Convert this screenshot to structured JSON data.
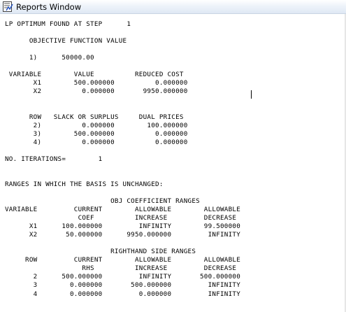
{
  "window": {
    "title": "Reports Window",
    "icon": "report-document-icon"
  },
  "report": {
    "lines": [
      "LP OPTIMUM FOUND AT STEP      1",
      "",
      "      OBJECTIVE FUNCTION VALUE",
      "",
      "      1)      50000.00",
      "",
      " VARIABLE        VALUE          REDUCED COST",
      "       X1        500.000000          0.000000",
      "       X2          0.000000       9950.000000",
      "",
      "",
      "      ROW   SLACK OR SURPLUS     DUAL PRICES",
      "       2)          0.000000        100.000000",
      "       3)        500.000000          0.000000",
      "       4)          0.000000          0.000000",
      "",
      "NO. ITERATIONS=        1",
      "",
      "",
      "RANGES IN WHICH THE BASIS IS UNCHANGED:",
      "",
      "                          OBJ COEFFICIENT RANGES",
      "VARIABLE         CURRENT        ALLOWABLE        ALLOWABLE",
      "                  COEF          INCREASE         DECREASE",
      "      X1      100.000000         INFINITY        99.500000",
      "      X2       50.000000      9950.000000         INFINITY",
      "",
      "                          RIGHTHAND SIDE RANGES",
      "     ROW         CURRENT        ALLOWABLE        ALLOWABLE",
      "                   RHS          INCREASE         DECREASE",
      "       2      500.000000         INFINITY       500.000000",
      "       3        0.000000       500.000000         INFINITY",
      "       4        0.000000         0.000000         INFINITY"
    ]
  }
}
